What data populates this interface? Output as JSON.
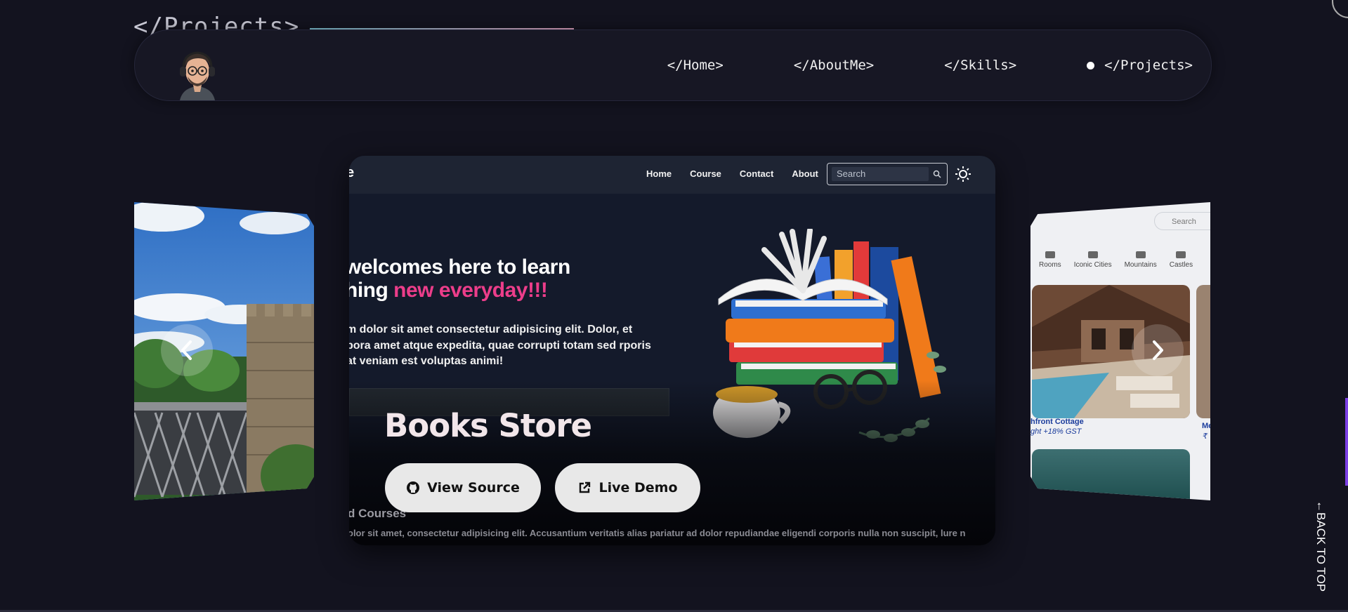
{
  "section": {
    "title": "</Projects>"
  },
  "nav": {
    "links": [
      {
        "label": "</Home>",
        "active": false
      },
      {
        "label": "</AboutMe>",
        "active": false
      },
      {
        "label": "</Skills>",
        "active": false
      },
      {
        "label": "</Projects>",
        "active": true
      }
    ]
  },
  "project": {
    "title": "Books Store",
    "view_source_label": "View Source",
    "live_demo_label": "Live Demo",
    "preview": {
      "logo_fragment": "e",
      "nav_links": [
        "Home",
        "Course",
        "Contact",
        "About"
      ],
      "search_placeholder": "Search",
      "hero_line1": "welcomes here to learn",
      "hero_line2_prefix": "hing",
      "hero_line2_highlight": "new everyday!!!",
      "paragraph": "m dolor sit amet consectetur adipisicing elit. Dolor, et pora amet atque expedita, quae corrupti totam sed rporis at veniam est voluptas animi!",
      "subtitle": "d Courses",
      "subtext": "olor sit amet, consectetur adipisicing elit. Accusantium veritatis alias pariatur ad dolor repudiandae eligendi corporis nulla non suscipit, lure n"
    }
  },
  "next_preview": {
    "search_placeholder": "Search",
    "categories": [
      "Rooms",
      "Iconic Cities",
      "Mountains",
      "Castles"
    ],
    "listing_name": "hfront Cottage",
    "listing_price": "ght  +18% GST",
    "listing2_name": "Me",
    "listing2_price": "₹"
  },
  "back_to_top": "←BACK TO TOP",
  "colors": {
    "background": "#13131f",
    "accent_pink": "#ec3d8a",
    "scroll_accent": "#7b3fe4"
  }
}
